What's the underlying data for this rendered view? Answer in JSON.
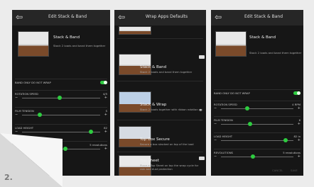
{
  "panel_left": {
    "title": "Edit Stack & Band",
    "app_name": "Stack & Band",
    "app_desc": "Stack 2 loads and band them together",
    "rows": [
      {
        "label": "BAND ONLY DO NOT WRAP",
        "value": ""
      },
      {
        "label": "ROTATION SPEED",
        "value": "4/5"
      },
      {
        "label": "FILM TENSION",
        "value": "S"
      },
      {
        "label": "LOAD HEIGHT",
        "value": "82"
      },
      {
        "label": "",
        "value": "5 revolutions"
      }
    ]
  },
  "panel_middle": {
    "title": "Wrap Apps Defaults",
    "items": [
      {
        "name": "Stack & Band",
        "desc": "Stack 2 loads and band them together"
      },
      {
        "name": "Stack & Wrap",
        "desc": "Stack 2 loads together with ribbon rotation"
      },
      {
        "name": "Top Box Secure",
        "desc": "Secure a box stacked on top of the load"
      },
      {
        "name": "Top Sheet",
        "desc": "Place a Top Sheet on top the wrap cycle for rain and dust protection"
      }
    ]
  },
  "panel_right": {
    "title": "Edit Stack & Band",
    "app_name": "Stack & Band",
    "app_desc": "Stack 2 loads and band them together",
    "rows": [
      {
        "label": "BAND ONLY DO NOT WRAP",
        "value": ""
      },
      {
        "label": "ROTATION SPEED",
        "value": "4 RPM"
      },
      {
        "label": "FILM TENSION",
        "value": "6"
      },
      {
        "label": "LOAD HEIGHT",
        "value": "82 in"
      },
      {
        "label": "REVOLUTIONS",
        "value": "5 revolutions"
      }
    ],
    "footer": [
      "CANCEL",
      "SAVE"
    ]
  },
  "step_number": "2.",
  "colors": {
    "accent": "#2ecc40",
    "panel_bg": "#161616",
    "page_bg": "#ececec"
  }
}
